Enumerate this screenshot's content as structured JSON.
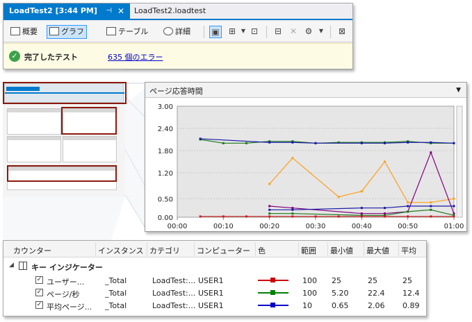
{
  "top_window": {
    "active_tab": "LoadTest2 [3:44 PM]",
    "active_tab_pin": "⊣",
    "active_tab_close": "✕",
    "inactive_tab": "LoadTest2.loadtest",
    "toolbar": {
      "summary": "概要",
      "graph": "グラフ",
      "table": "テーブル",
      "details": "詳細"
    },
    "status": {
      "icon": "✓",
      "text": "完了したテスト",
      "error_link": "635 個のエラー"
    }
  },
  "chart_panel": {
    "dropdown_arrow": "▼"
  },
  "chart_data": {
    "type": "line",
    "title": "ページ応答時間",
    "y_ticks": [
      "3.00",
      "2.40",
      "1.80",
      "1.20",
      "0.50",
      "0.00"
    ],
    "x_ticks": [
      "00:00",
      "00:10",
      "00:20",
      "00:30",
      "00:40",
      "00:50",
      "01:00"
    ],
    "ylim": [
      0,
      3.0
    ],
    "xlim_seconds": [
      0,
      60
    ],
    "series": [
      {
        "color": "#1a7a1a",
        "points": [
          [
            5,
            2.1
          ],
          [
            10,
            2.0
          ],
          [
            15,
            2.0
          ],
          [
            20,
            2.05
          ],
          [
            25,
            2.05
          ],
          [
            30,
            2.0
          ],
          [
            35,
            2.02
          ],
          [
            40,
            2.02
          ],
          [
            45,
            2.02
          ],
          [
            50,
            2.05
          ],
          [
            55,
            2.0
          ],
          [
            60,
            2.0
          ]
        ]
      },
      {
        "color": "#1a1aa8",
        "points": [
          [
            5,
            2.12
          ],
          [
            20,
            2.02
          ],
          [
            25,
            2.02
          ],
          [
            30,
            2.0
          ],
          [
            40,
            2.0
          ],
          [
            45,
            2.0
          ],
          [
            50,
            2.02
          ],
          [
            55,
            2.02
          ],
          [
            60,
            2.0
          ]
        ]
      },
      {
        "color": "#ff9f1a",
        "points": [
          [
            20,
            0.9
          ],
          [
            25,
            1.6
          ],
          [
            35,
            0.55
          ],
          [
            40,
            0.7
          ],
          [
            45,
            1.5
          ],
          [
            50,
            0.4
          ],
          [
            55,
            0.4
          ],
          [
            60,
            0.5
          ]
        ]
      },
      {
        "color": "#800080",
        "points": [
          [
            20,
            0.3
          ],
          [
            25,
            0.25
          ],
          [
            40,
            0.1
          ],
          [
            45,
            0.1
          ],
          [
            50,
            0.15
          ],
          [
            55,
            1.75
          ],
          [
            60,
            0.1
          ]
        ]
      },
      {
        "color": "#1a1aa8",
        "points": [
          [
            20,
            0.2
          ],
          [
            25,
            0.2
          ],
          [
            40,
            0.25
          ],
          [
            45,
            0.25
          ],
          [
            50,
            0.3
          ],
          [
            55,
            0.3
          ],
          [
            60,
            0.3
          ]
        ]
      },
      {
        "color": "#1a7a1a",
        "points": [
          [
            20,
            0.1
          ],
          [
            25,
            0.1
          ],
          [
            40,
            0.05
          ],
          [
            45,
            0.05
          ],
          [
            50,
            0.15
          ],
          [
            55,
            0.2
          ],
          [
            60,
            0.05
          ]
        ]
      },
      {
        "color": "#cc1a1a",
        "points": [
          [
            5,
            0.02
          ],
          [
            10,
            0.02
          ],
          [
            15,
            0.02
          ],
          [
            20,
            0.02
          ],
          [
            25,
            0.02
          ],
          [
            30,
            0.02
          ],
          [
            35,
            0.02
          ],
          [
            40,
            0.02
          ],
          [
            45,
            0.02
          ],
          [
            50,
            0.02
          ],
          [
            55,
            0.02
          ],
          [
            60,
            0.02
          ]
        ]
      }
    ]
  },
  "counter_table": {
    "columns": [
      "カウンター",
      "インスタンス",
      "カテゴリ",
      "コンピューター",
      "色",
      "範囲",
      "最小値",
      "最大値",
      "平均"
    ],
    "group_arrow": "◢",
    "group_label": "キー インジケーター",
    "rows": [
      {
        "check": "✓",
        "counter": "ユーザー...",
        "instance": "_Total",
        "category": "LoadTest:...",
        "computer": "USER1",
        "color": "#cc0000",
        "range": "100",
        "min": "25",
        "max": "25",
        "avg": "25"
      },
      {
        "check": "✓",
        "counter": "ページ/秒",
        "instance": "_Total",
        "category": "LoadTest:...",
        "computer": "USER1",
        "color": "#008000",
        "range": "100",
        "min": "5.20",
        "max": "22.4",
        "avg": "12.4"
      },
      {
        "check": "✓",
        "counter": "平均ページ...",
        "instance": "_Total",
        "category": "LoadTest:...",
        "computer": "USER1",
        "color": "#0000cc",
        "range": "10",
        "min": "0.65",
        "max": "2.06",
        "avg": "0.89"
      }
    ]
  }
}
